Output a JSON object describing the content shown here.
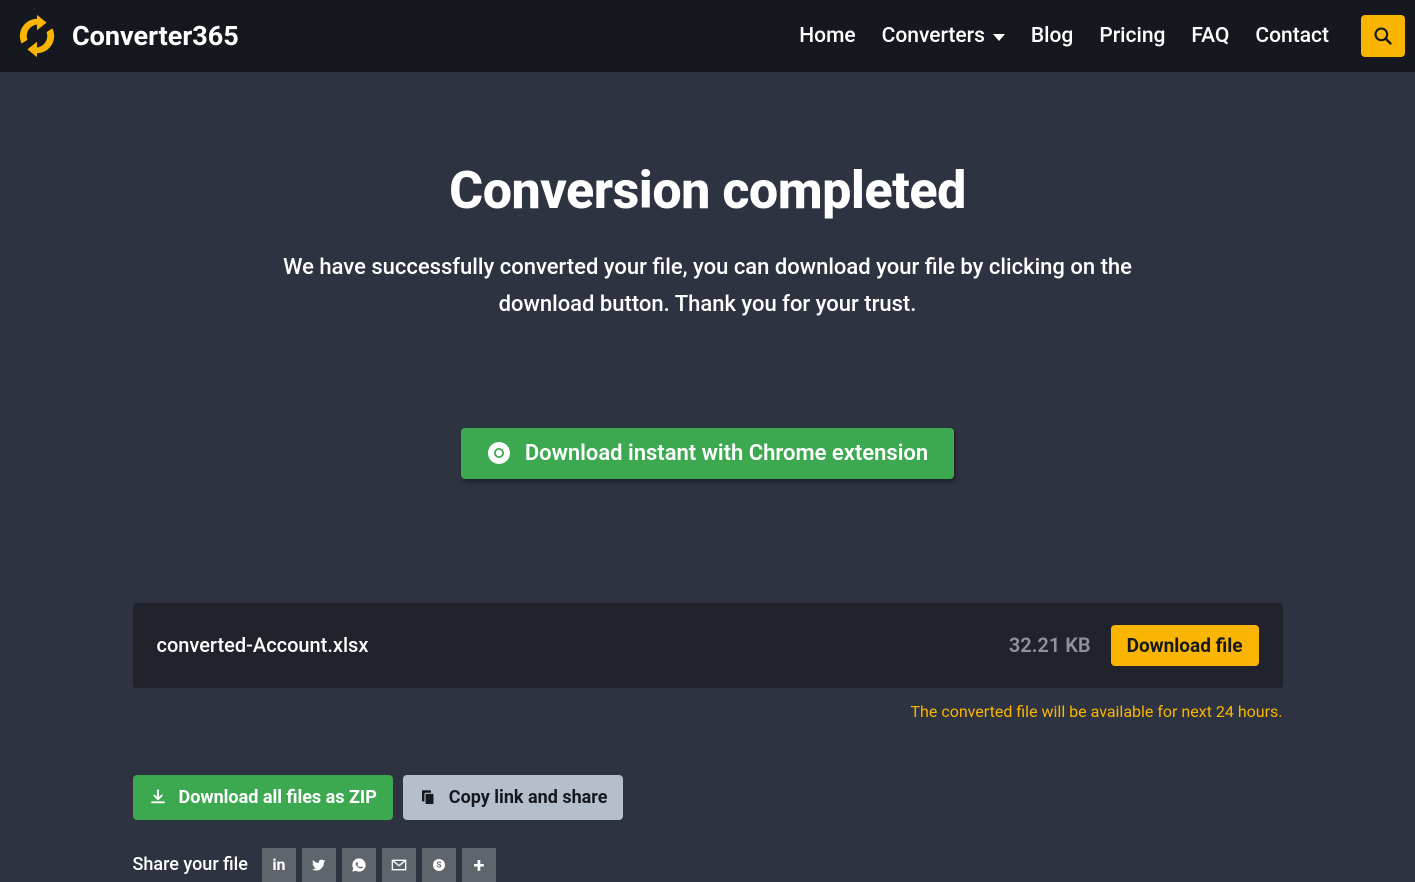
{
  "brand": "Converter365",
  "nav": {
    "home": "Home",
    "converters": "Converters",
    "blog": "Blog",
    "pricing": "Pricing",
    "faq": "FAQ",
    "contact": "Contact"
  },
  "main": {
    "title": "Conversion completed",
    "subtitle": "We have successfully converted your file, you can download your file by clicking on the download button. Thank you for your trust.",
    "chrome_button": "Download instant with Chrome extension"
  },
  "file": {
    "name": "converted-Account.xlsx",
    "size": "32.21 KB",
    "download_label": "Download file"
  },
  "note": "The converted file will be available for next 24 hours.",
  "actions": {
    "zip": "Download all files as ZIP",
    "copy": "Copy link and share"
  },
  "share": {
    "label": "Share your file"
  }
}
